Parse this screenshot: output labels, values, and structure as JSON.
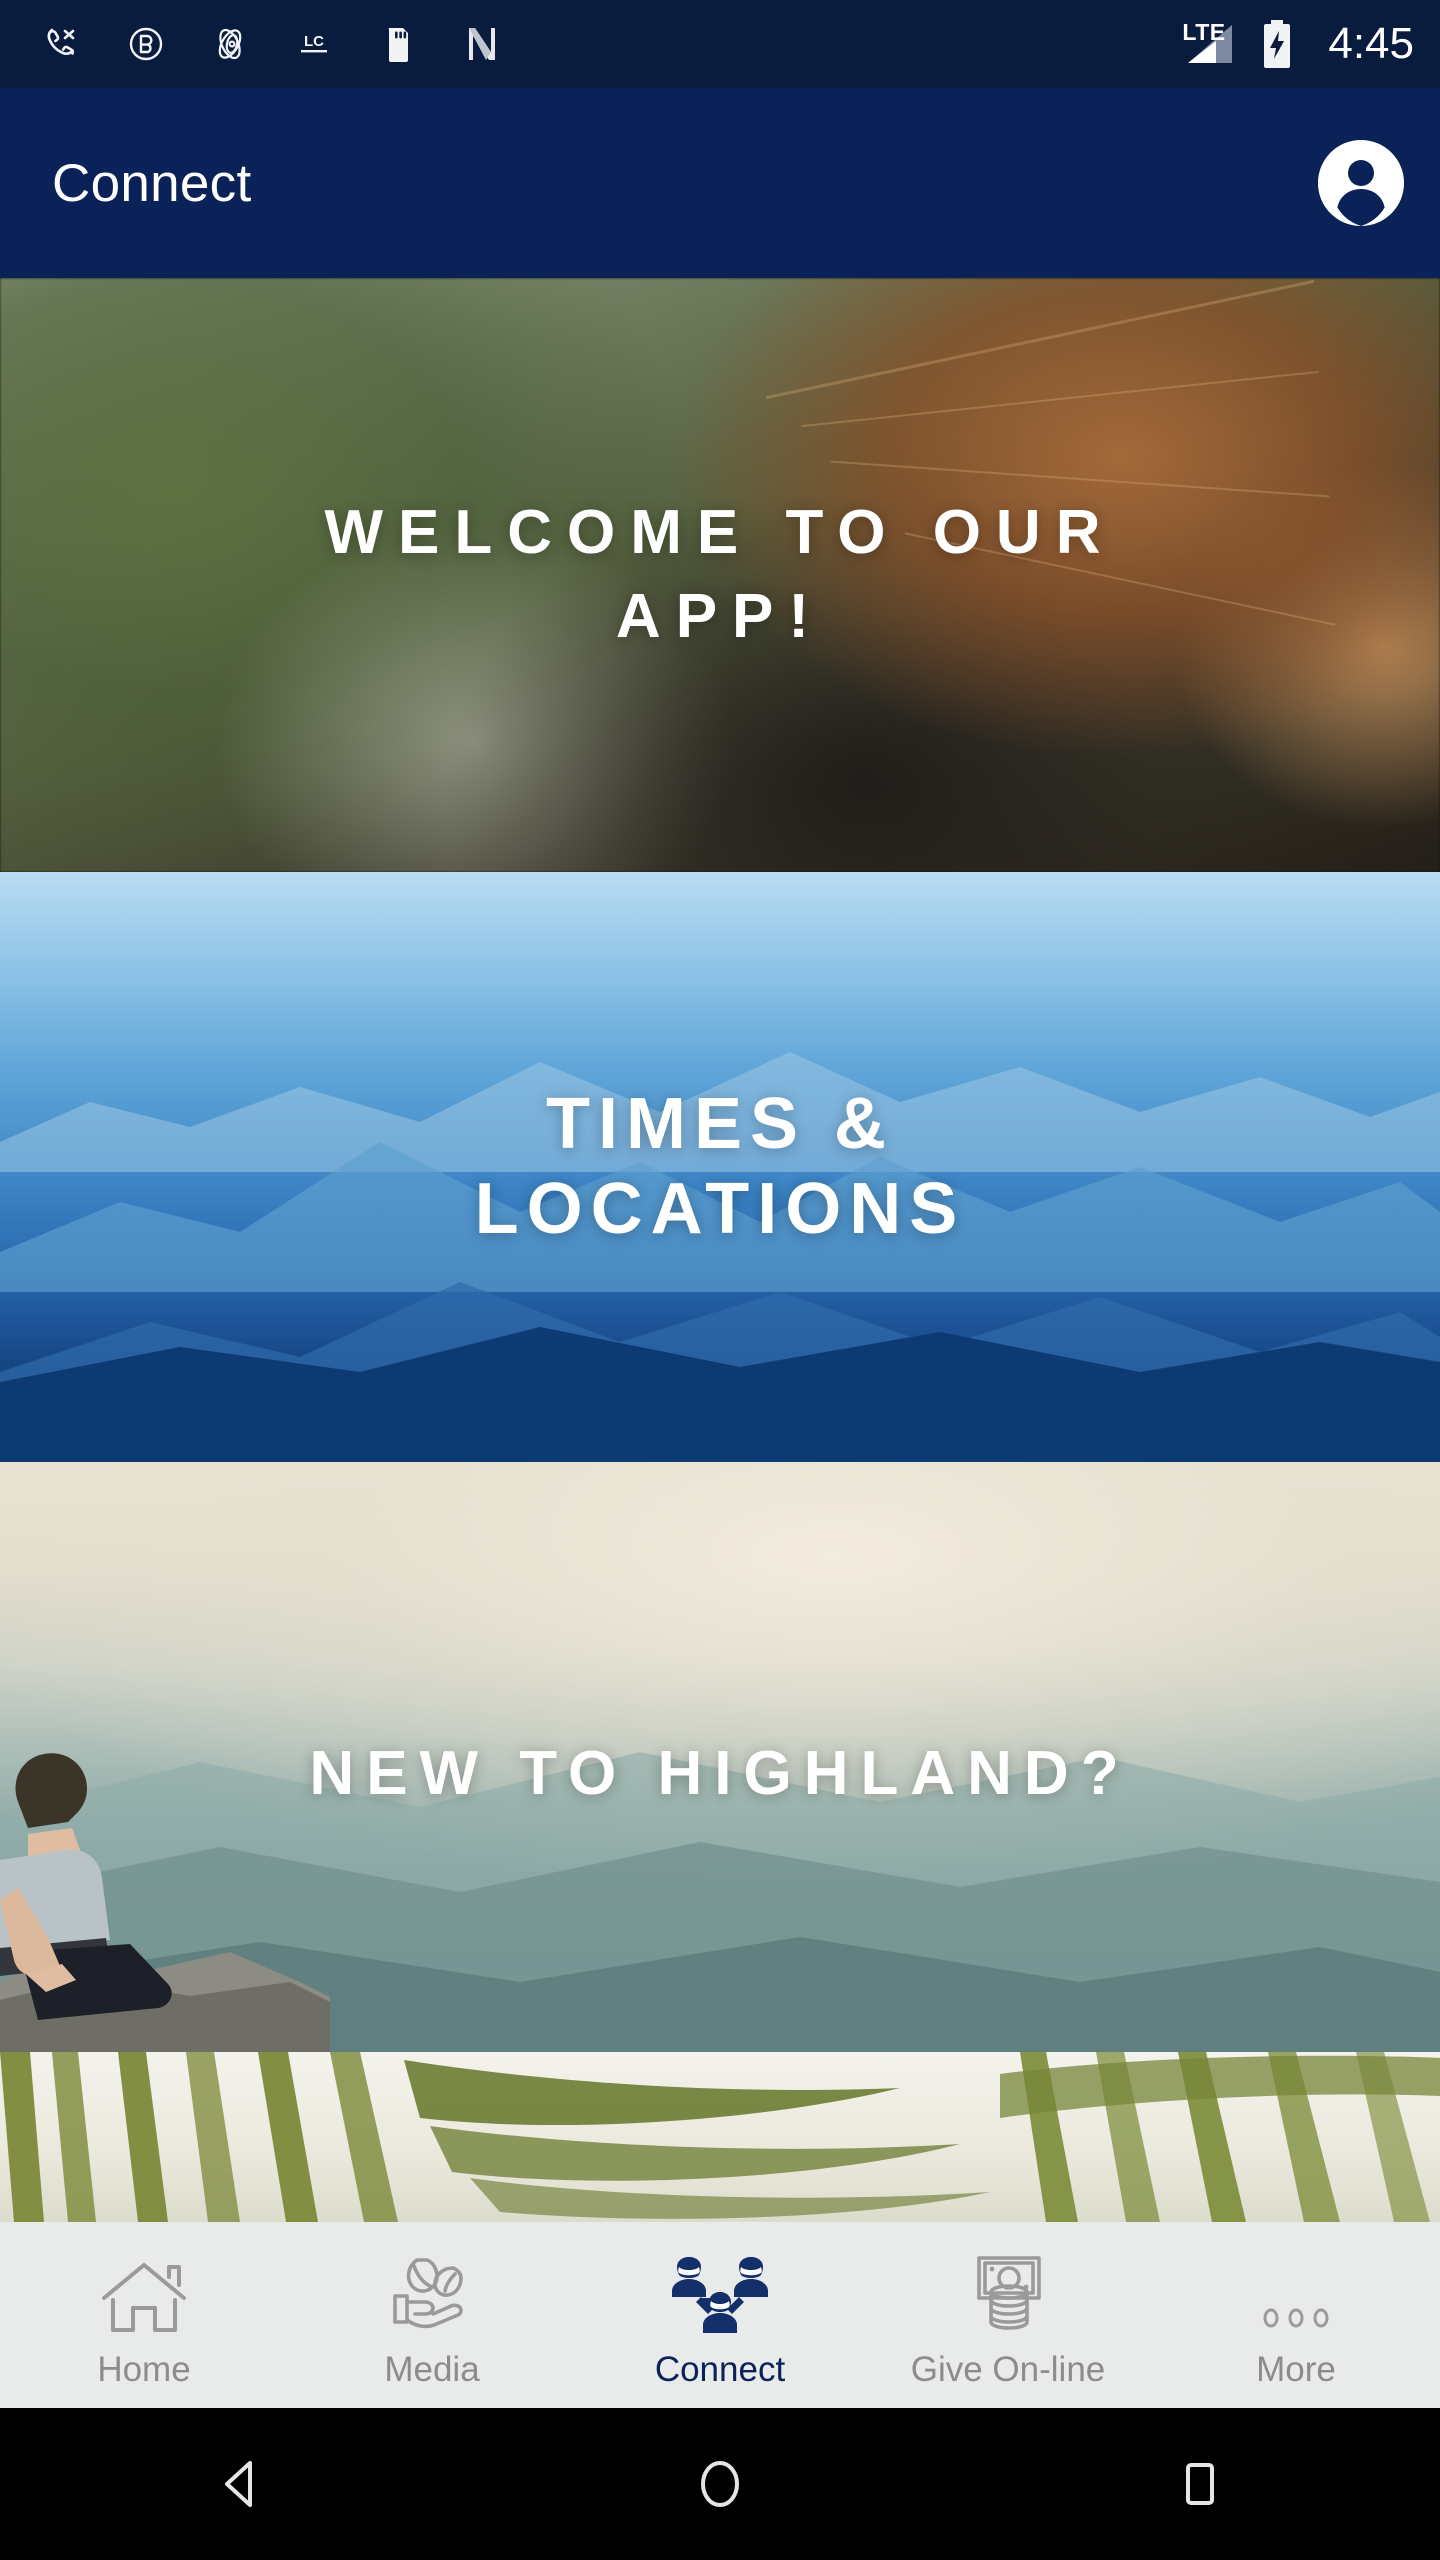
{
  "status_bar": {
    "icons": [
      {
        "name": "phone-missed-icon",
        "label": "phone"
      },
      {
        "name": "lastpass-icon",
        "label": "LB"
      },
      {
        "name": "atom-icon",
        "label": "atom"
      },
      {
        "name": "lc-icon",
        "label": "LC"
      },
      {
        "name": "sd-card-icon",
        "label": "sd card"
      },
      {
        "name": "nova-launcher-icon",
        "label": "N"
      }
    ],
    "network": "LTE",
    "signal_bars": 2,
    "battery_state": "charging",
    "time": "4:45"
  },
  "app_bar": {
    "title": "Connect",
    "account_icon": "account-circle-icon"
  },
  "banners": [
    {
      "id": "b1",
      "title": "WELCOME TO OUR APP!",
      "line1": "WELCOME TO OUR",
      "line2": "APP!",
      "image": "woman-with-phone-outdoors"
    },
    {
      "id": "b2",
      "title": "TIMES & LOCATIONS",
      "line1": "TIMES &",
      "line2": "LOCATIONS",
      "image": "blue-mountain-ridges"
    },
    {
      "id": "b3",
      "title": "NEW TO HIGHLAND?",
      "line1": "NEW TO HIGHLAND?",
      "line2": "",
      "image": "man-sitting-on-cliff-overlook"
    },
    {
      "id": "b4",
      "title": "",
      "line1": "",
      "line2": "",
      "image": "palm-fronds"
    }
  ],
  "tab_bar": {
    "active_index": 2,
    "active_color": "#0b2258",
    "inactive_color": "#8c8c8c",
    "background": "#e9eaea",
    "items": [
      {
        "label": "Home",
        "icon": "home-icon"
      },
      {
        "label": "Media",
        "icon": "hand-leaf-icon"
      },
      {
        "label": "Connect",
        "icon": "people-group-icon"
      },
      {
        "label": "Give On-line",
        "icon": "money-icon"
      },
      {
        "label": "More",
        "icon": "more-dots-icon"
      }
    ]
  },
  "android_nav": {
    "back": "back-triangle-icon",
    "home": "home-circle-icon",
    "recents": "recents-square-icon"
  },
  "colors": {
    "status_bar": "#0a1c3e",
    "app_bar": "#0b2258",
    "brand_navy": "#0b2258"
  }
}
